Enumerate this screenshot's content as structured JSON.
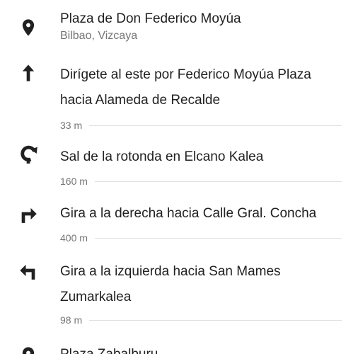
{
  "origin": {
    "title": "Plaza de Don Federico Moyúa",
    "subtitle": "Bilbao, Vizcaya",
    "icon": "location-pin-icon"
  },
  "steps": [
    {
      "icon": "arrow-up-icon",
      "text": "Dirígete al este por Federico Moyúa Plaza hacia Alameda de Recalde",
      "distance": "33 m"
    },
    {
      "icon": "roundabout-exit-icon",
      "text": "Sal de la rotonda en Elcano Kalea",
      "distance": "160 m"
    },
    {
      "icon": "turn-right-icon",
      "text": "Gira a la derecha hacia Calle Gral. Concha",
      "distance": "400 m"
    },
    {
      "icon": "turn-left-icon",
      "text": "Gira a la izquierda hacia San Mames Zumarkalea",
      "distance": "98 m"
    }
  ],
  "destination": {
    "title": "Plaza Zabalburu",
    "icon": "location-pin-icon"
  },
  "colors": {
    "text_primary": "#212121",
    "text_secondary": "#757575",
    "divider": "#e0e0e0",
    "icon": "#212121"
  }
}
